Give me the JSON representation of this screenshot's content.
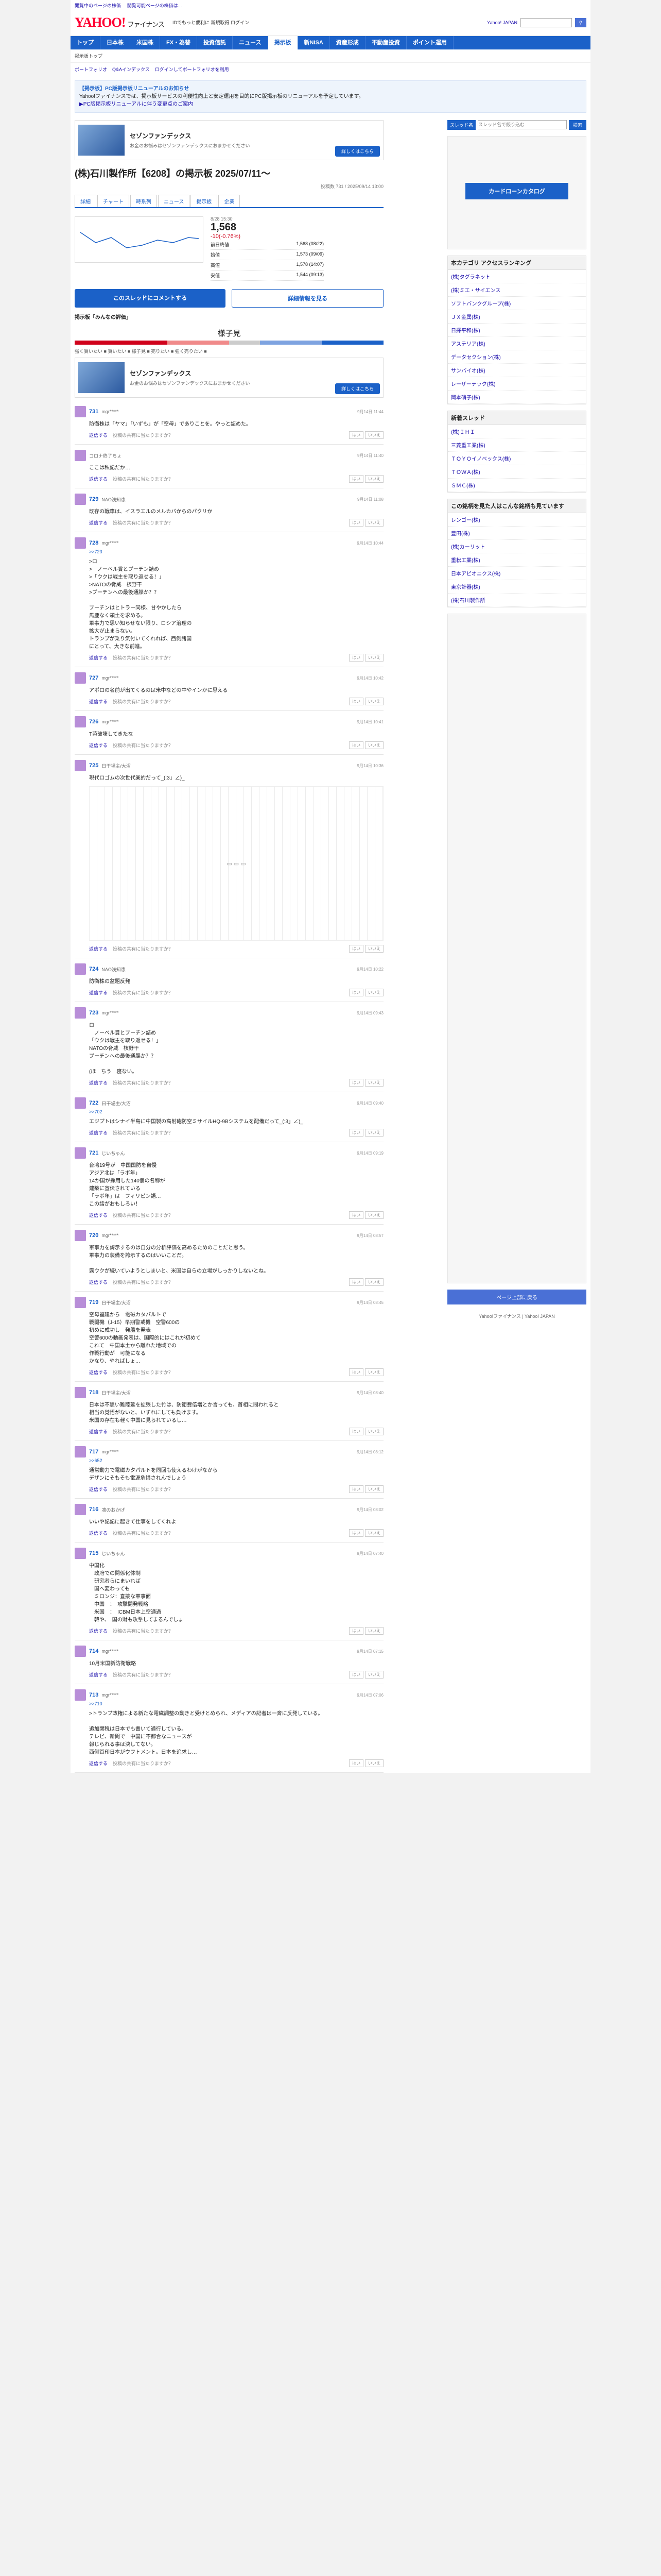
{
  "topstrip": [
    "閲覧中のページの株価",
    "閲覧可能ページの株価は..."
  ],
  "header": {
    "logo": "YAHOO!",
    "logo_sub": "ファイナンス",
    "links": "IDでもっと便利に 新規取得 ログイン",
    "right_link": "Yahoo! JAPAN",
    "search_placeholder": ""
  },
  "gnav": [
    "トップ",
    "日本株",
    "米国株",
    "FX・為替",
    "投資信託",
    "ニュース",
    "掲示板",
    "新NISA",
    "資産形成",
    "不動産投資",
    "ポイント運用"
  ],
  "crumb": "掲示板トップ",
  "subnav": [
    "ポートフォリオ",
    "Q&Aインデックス",
    "ログインしてポートフォリオを利用"
  ],
  "notice": {
    "title": "【掲示板】PC版掲示板リニューアルのお知らせ",
    "body": "Yahoo!ファイナンスでは、掲示板サービスの利便性向上と安定運用を目的にPC版掲示板のリニューアルを予定しています。",
    "link": "▶PC版掲示板リニューアルに伴う変更点のご案内"
  },
  "ad1": {
    "title": "セゾンファンデックス",
    "desc": "お金のお悩みはセゾンファンデックスにおまかせください",
    "btn": "詳しくはこちら"
  },
  "board": {
    "title": "(株)石川製作所【6208】の掲示板 2025/07/11〜",
    "meta": "投稿数 731 / 2025/09/14 13:00",
    "tabs": [
      "詳細",
      "チャート",
      "時系列",
      "ニュース",
      "掲示板",
      "企業"
    ]
  },
  "quote": {
    "date": "8/28 15:30",
    "price": "1,568",
    "change": "-10(-0.76%)",
    "rows": [
      {
        "k": "前日終値",
        "v": "1,568 (08/22)"
      },
      {
        "k": "始値",
        "v": "1,573 (09/09)"
      },
      {
        "k": "高値",
        "v": "1,578 (14:07)"
      },
      {
        "k": "安値",
        "v": "1,544 (09:13)"
      }
    ]
  },
  "cta": {
    "a": "このスレッドにコメントする",
    "b": "詳細情報を見る"
  },
  "sentiment": {
    "label": "掲示板「みんなの評価」",
    "value": "様子見",
    "legend": "強く買いたい ■ 買いたい ■ 様子見 ■ 売りたい ■ 強く売りたい ■"
  },
  "posts": [
    {
      "num": "731",
      "name": "mgr*****",
      "date": "9月14日 11:44",
      "reply": "",
      "text": "防衛株は「ヤマ」「いずも」が「空母」でありことを。やっと認めた。"
    },
    {
      "num": "",
      "name": "コロナ終了ちょ",
      "date": "9月14日 11:40",
      "reply": "",
      "text": "ここは私記だか…"
    },
    {
      "num": "729",
      "name": "NAO浅知恵",
      "date": "9月14日 11:08",
      "reply": "",
      "text": "既存の戦車は、イスラエルのメルカバからのパクリか"
    },
    {
      "num": "728",
      "name": "mgr*****",
      "date": "9月14日 10:44",
      "reply": ">>723",
      "text": ">ロ\n>　ノーベル賞とプーチン詰め\n>「ウクは戦主を取り返せる！」\n>NATOの脅威　核野干\n>プーチンへの最後通牒か？？\n\nプーチンはヒトラー同様、甘やかしたら\n馬鹿なく領土を求める。\n軍事力で思い知らせない限り、ロシア治理の\n拡大が止まらない。\nトランプが乗り気付いてくれれば、西側諸国\nにとって、大きな前進。"
    },
    {
      "num": "727",
      "name": "mgr*****",
      "date": "9月14日 10:42",
      "reply": "",
      "text": "アポロの名前が出てくるのは米中などの中やインかに思える"
    },
    {
      "num": "726",
      "name": "mgr*****",
      "date": "9月14日 10:41",
      "reply": "",
      "text": "T芭破壊してきたな"
    },
    {
      "num": "725",
      "name": "日干場主/大沼",
      "date": "9月14日 10:36",
      "reply": "",
      "text": "現代ロゴムの次世代業的だって_(:3」∠)_"
    },
    {
      "num": "724",
      "name": "NAO浅知恵",
      "date": "9月14日 10:22",
      "reply": "",
      "text": "防衛株の盆題反発"
    },
    {
      "num": "723",
      "name": "mgr*****",
      "date": "9月14日 09:43",
      "reply": "",
      "text": "ロ\n　ノーベル賞とプーチン詰め\n「ウクは戦主を取り返せる！」\nNATOの脅威　核野干\nプーチンへの最後通牒か？？\n\n(ほ　ちう　寝ない。"
    },
    {
      "num": "722",
      "name": "日干場主/大沼",
      "date": "9月14日 09:40",
      "reply": ">>702",
      "text": "エジプトはシナイ半島に中国製の高射砲防空ミサイルHQ-9Bシステムを配備だって_(:3」∠)_"
    },
    {
      "num": "721",
      "name": "じいちゃん",
      "date": "9月14日 09:19",
      "reply": "",
      "text": "台湾19号が　中国国防を自慢\nアジア北は「ラボ年」\n14か国が採用した140個の名称が\n建築に宣伝されている\n「ラボ年」は　フィリピン語…\nこの話がおもしろい！"
    },
    {
      "num": "720",
      "name": "mgr*****",
      "date": "9月14日 08:57",
      "reply": "",
      "text": "軍事力を誇示するのは自分の分析評価を高めるためのことだと思う。\n軍事力の装備を誇示するのはいいことだ。\n\n露ウクが続いていようとしまいと、米国は自らの立場がしっかりしないとね。"
    },
    {
      "num": "719",
      "name": "日干場主/大沼",
      "date": "9月14日 08:45",
      "reply": "",
      "text": "空母福建から　電磁カタパルトで\n戦闘機（J-15）早期警戒機　空警600の\n初めに成功し　発艦を発表\n空警600の動画発表は、国際的にはこれが初めて\nこれて　中国本土から離れた地域での\n作戦行動が　可能になる\nかなり、やればしょ…"
    },
    {
      "num": "718",
      "name": "日干場主/大沼",
      "date": "9月14日 08:40",
      "reply": "",
      "text": "日本は不思い難陸延を拡張した竹は、防衛費倍増とか言っても、首相に問われると\n相当の覚悟がないと、いずれにしても負けます。\n米国の存在も軽く中国に見られているし…"
    },
    {
      "num": "717",
      "name": "mgr*****",
      "date": "9月14日 08:12",
      "reply": ">>652",
      "text": "通常動力で電磁カタパルトを同回も使えるわけがなから\nデザンにそもそも電源危惧されんでしょう"
    },
    {
      "num": "716",
      "name": "凛のおかげ",
      "date": "9月14日 08:02",
      "reply": "",
      "text": "いいや記記に起きて仕事をしてくれよ"
    },
    {
      "num": "715",
      "name": "じいちゃん",
      "date": "9月14日 07:40",
      "reply": "",
      "text": "中国化\n　政府での関係化体制\n　研究者らにまいれば\n　国へ変わっても\n　ミロンジ：直接な軍事面\n　中国　：　攻撃開発戦略\n　米国　：　ICBM日本上空通過\n　韓や、　国の財も攻撃してまるんでしょ"
    },
    {
      "num": "714",
      "name": "mgr*****",
      "date": "9月14日 07:15",
      "reply": "",
      "text": "10月米国新防衛戦略"
    },
    {
      "num": "713",
      "name": "mgr*****",
      "date": "9月14日 07:06",
      "reply": ">>710",
      "text": ">トランプ政権による新たな電磁調整の動きと受けとめられ、メディアの記者は一斉に反発している。\n\n追加関税は日本でも書いて通行している。\nテレビ、新聞で　中国に不都合なニュースが\n報じられる事は決してない。\n西側首印日本がウフトメント。日本を追求し…"
    }
  ],
  "post_footer": {
    "reply": "返信する",
    "report": "投稿の共有に当たりますか？",
    "yes": "はい",
    "no": "いいえ"
  },
  "side": {
    "search_label": "スレッド名",
    "search_placeholder": "スレッド名で絞り込む",
    "search_btn": "検索",
    "ad_text": "カードローンカタログ",
    "ranking_title": "本カテゴリ アクセスランキング",
    "ranking": [
      "(株)タグラネット",
      "(株)ミエ・サイエンス",
      "ソフトバンクグループ(株)",
      "ＪＸ金属(株)",
      "日揮平和(株)",
      "アステリア(株)",
      "データセクション(株)",
      "サンバイオ(株)",
      "レーザーテック(株)",
      "岡本硝子(株)"
    ],
    "new_title": "新着スレッド",
    "new": [
      "(株)ＩＨＩ",
      "三菱重工業(株)",
      "ＴＯＹＯイノベックス(株)",
      "ＴＯＷＡ(株)",
      "ＳＭＣ(株)"
    ],
    "also_title": "この銘柄を見た人はこんな銘柄も見ています",
    "also": [
      "レンゴー(株)",
      "豊田(株)",
      "(株)カーリット",
      "重松工業(株)",
      "日本アビオニクス(株)",
      "東京計器(株)",
      "(株)石川製作所"
    ],
    "top_btn": "ページ上部に戻る",
    "footer": "Yahoo!ファイナンス | Yahoo! JAPAN"
  },
  "colors": {
    "brand": "#ff0033",
    "nav": "#1b61c8"
  }
}
